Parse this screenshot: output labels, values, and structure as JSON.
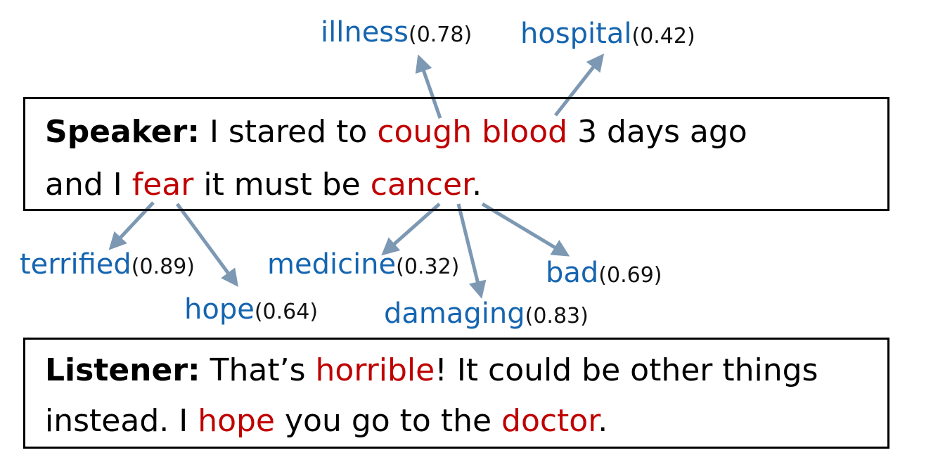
{
  "speaker": {
    "role": "Speaker:",
    "line1": [
      {
        "text": "I stared to ",
        "hl": false
      },
      {
        "text": "cough",
        "hl": true
      },
      {
        "text": " ",
        "hl": false
      },
      {
        "text": "blood",
        "hl": true
      },
      {
        "text": " 3 days ago",
        "hl": false
      }
    ],
    "line2": [
      {
        "text": "and I ",
        "hl": false
      },
      {
        "text": "fear",
        "hl": true
      },
      {
        "text": " it must be ",
        "hl": false
      },
      {
        "text": "cancer",
        "hl": true
      },
      {
        "text": ".",
        "hl": false
      }
    ]
  },
  "listener": {
    "role": "Listener:",
    "line1": [
      {
        "text": "That’s ",
        "hl": false
      },
      {
        "text": "horrible",
        "hl": true
      },
      {
        "text": "! It could be other things",
        "hl": false
      }
    ],
    "line2": [
      {
        "text": "instead. I ",
        "hl": false
      },
      {
        "text": "hope",
        "hl": true
      },
      {
        "text": " you go to the ",
        "hl": false
      },
      {
        "text": "doctor",
        "hl": true
      },
      {
        "text": ".",
        "hl": false
      }
    ]
  },
  "concepts": {
    "illness": {
      "word": "illness",
      "score": "(0.78)"
    },
    "hospital": {
      "word": "hospital",
      "score": "(0.42)"
    },
    "terrified": {
      "word": "terrified",
      "score": "(0.89)"
    },
    "hope": {
      "word": "hope",
      "score": "(0.64)"
    },
    "medicine": {
      "word": "medicine",
      "score": "(0.32)"
    },
    "damaging": {
      "word": "damaging",
      "score": "(0.83)"
    },
    "bad": {
      "word": "bad",
      "score": "(0.69)"
    }
  },
  "colors": {
    "highlight": "#c00000",
    "concept": "#1565b0",
    "arrow": "#7d98b3",
    "border": "#000000"
  }
}
